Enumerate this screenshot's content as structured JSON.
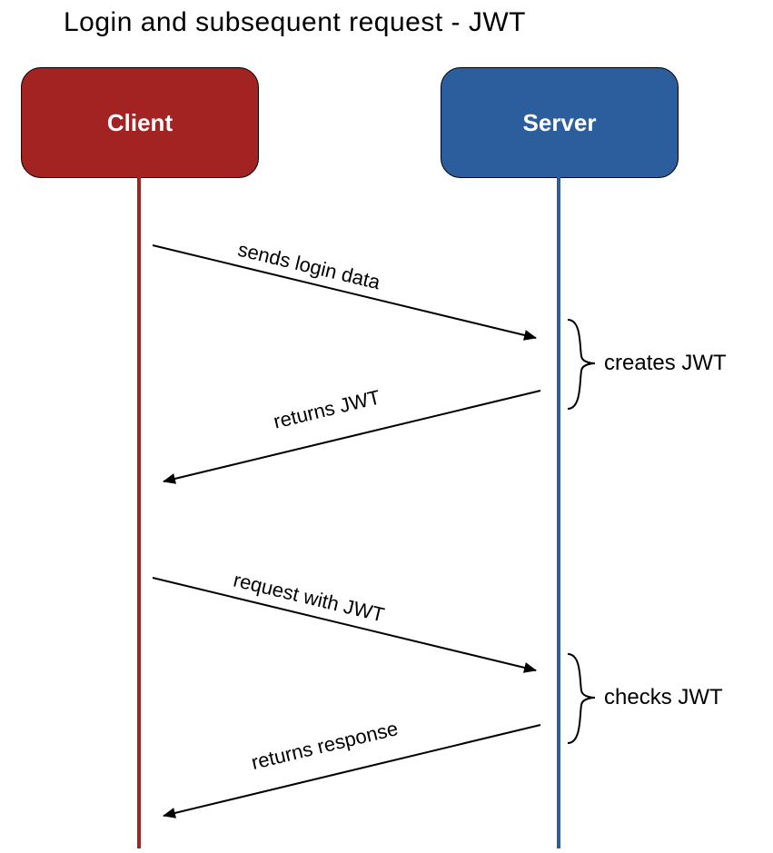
{
  "title": "Login and subsequent request - JWT",
  "actors": {
    "client": {
      "label": "Client",
      "color": "#A32222"
    },
    "server": {
      "label": "Server",
      "color": "#2C5D9D"
    }
  },
  "messages": [
    {
      "id": "m1",
      "from": "client",
      "to": "server",
      "label": "sends login data"
    },
    {
      "id": "m2",
      "from": "server",
      "to": "client",
      "label": "returns JWT"
    },
    {
      "id": "m3",
      "from": "client",
      "to": "server",
      "label": "request with JWT"
    },
    {
      "id": "m4",
      "from": "server",
      "to": "client",
      "label": "returns response"
    }
  ],
  "notes": [
    {
      "id": "n1",
      "on": "server",
      "between": [
        "m1",
        "m2"
      ],
      "label": "creates JWT"
    },
    {
      "id": "n2",
      "on": "server",
      "between": [
        "m3",
        "m4"
      ],
      "label": "checks JWT"
    }
  ]
}
